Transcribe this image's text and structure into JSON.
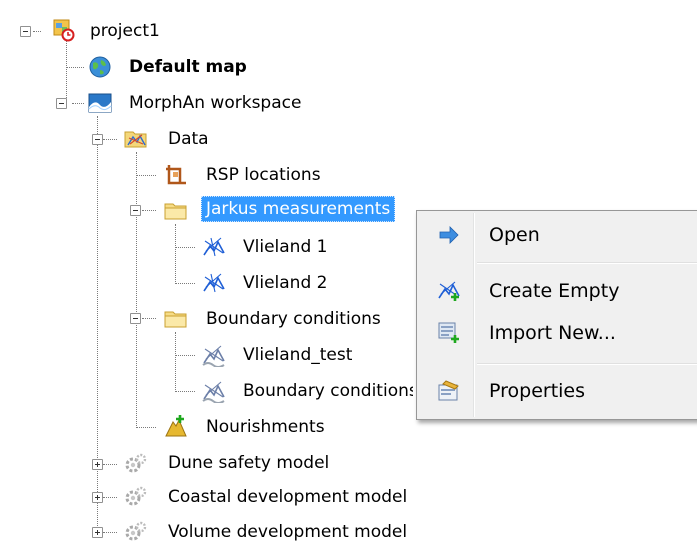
{
  "tree": {
    "project": "project1",
    "default_map": "Default map",
    "workspace": "MorphAn workspace",
    "data": "Data",
    "rsp_locations": "RSP locations",
    "jarkus": "Jarkus measurements",
    "vlieland1": "Vlieland 1",
    "vlieland2": "Vlieland 2",
    "boundary": "Boundary conditions",
    "vlieland_test": "Vlieland_test",
    "boundary_child": "Boundary conditions",
    "nourishments": "Nourishments",
    "dune_model": "Dune safety model",
    "coastal_model": "Coastal development model",
    "volume_model": "Volume development model"
  },
  "context_menu": {
    "open": "Open",
    "create_empty": "Create Empty",
    "import_new": "Import New...",
    "properties": "Properties"
  },
  "colors": {
    "selection": "#3399ff",
    "menu_bg": "#f0f0f0"
  }
}
